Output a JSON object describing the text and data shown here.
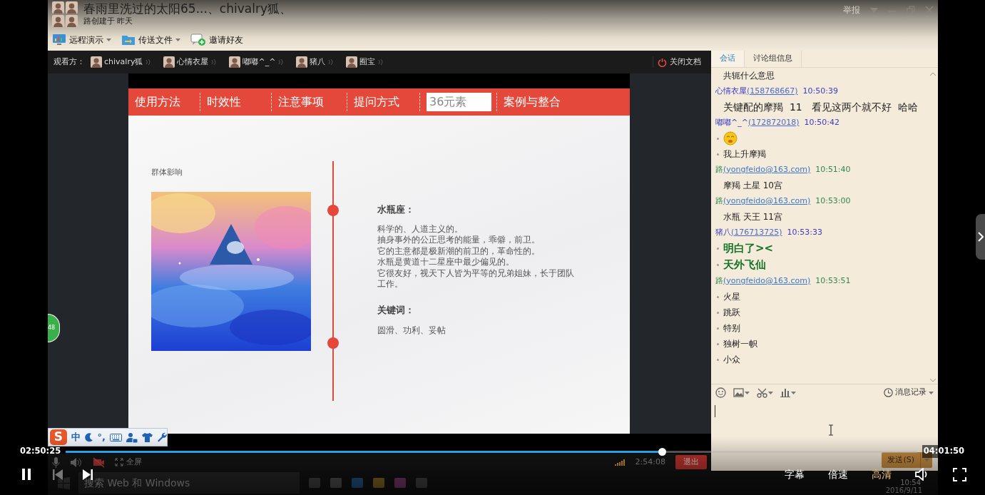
{
  "window": {
    "title": "春雨里洗过的太阳65...、chivalry狐、",
    "subtitle": "路创建于 昨天",
    "report": "举报"
  },
  "toolbar": [
    {
      "label": "远程演示",
      "dropdown": true,
      "kind": "screen"
    },
    {
      "label": "传送文件",
      "dropdown": true,
      "kind": "folder"
    },
    {
      "label": "邀请好友",
      "dropdown": false,
      "kind": "invite"
    }
  ],
  "viewers": {
    "label": "观看方：",
    "people": [
      {
        "name": "chivalry狐"
      },
      {
        "name": "心情衣屋"
      },
      {
        "name": "嘟嘟^_^"
      },
      {
        "name": "猪八"
      },
      {
        "name": "囿宝"
      }
    ]
  },
  "close_doc": "关闭文档",
  "slide": {
    "nav": [
      {
        "label": "使用方法",
        "selected": false
      },
      {
        "label": "时效性",
        "selected": false
      },
      {
        "label": "注意事项",
        "selected": false
      },
      {
        "label": "提问方式",
        "selected": false
      },
      {
        "label": "36元素",
        "selected": true
      },
      {
        "label": "案例与整合",
        "selected": false
      }
    ],
    "section": "群体影响",
    "heading": "水瓶座：",
    "lines": [
      "科学的、人道主义的。",
      "抽身事外的公正思考的能量，乖僻，前卫。",
      "它的主意都是极新潮的前卫的，革命性的。",
      "水瓶是黄道十二星座中最少偏见的。",
      "它很友好，视天下人皆为平等的兄弟姐妹，长于团队工作。"
    ],
    "keywords_heading": "关键词：",
    "keywords": "圆滑、功利、妥帖"
  },
  "badge": "48",
  "ime": {
    "logo": "S",
    "mode": "中",
    "punct": "°,"
  },
  "call_bar": {
    "camera_off": true,
    "fullscreen": "全屏",
    "duration": "2:54:08",
    "exit": "退出"
  },
  "chat": {
    "tabs": [
      {
        "label": "会话",
        "selected": true
      },
      {
        "label": "讨论组信息",
        "selected": false
      }
    ],
    "messages": [
      {
        "lines": [
          {
            "kind": "text",
            "bulleted": false,
            "text": "共轭什么意思"
          }
        ]
      },
      {
        "sender": "心情衣屋",
        "account": "(158768667)",
        "time": "10:50:39",
        "self": false,
        "lines": [
          {
            "kind": "text",
            "bulleted": false,
            "text": "关键配的摩羯  11   看见这两个就不好  哈哈"
          }
        ]
      },
      {
        "sender": "嘟嘟^_^",
        "account": "(172872018)",
        "time": "10:50:42",
        "self": false,
        "lines": [
          {
            "kind": "emoji",
            "bulleted": true
          },
          {
            "kind": "text",
            "bulleted": true,
            "text": "我上升摩羯"
          }
        ]
      },
      {
        "sender": "路",
        "account": "(yongfeido@163.com)",
        "time": "10:51:40",
        "self": true,
        "lines": [
          {
            "kind": "text",
            "bulleted": false,
            "text": "摩羯 土星 10宫"
          }
        ]
      },
      {
        "sender": "路",
        "account": "(yongfeido@163.com)",
        "time": "10:53:00",
        "self": true,
        "lines": [
          {
            "kind": "text",
            "bulleted": false,
            "text": "水瓶 天王 11宫"
          }
        ]
      },
      {
        "sender": "猪八",
        "account": "(176713725)",
        "time": "10:53:33",
        "self": false,
        "lines": [
          {
            "kind": "big",
            "bulleted": true,
            "text": "明白了><"
          },
          {
            "kind": "big",
            "bulleted": true,
            "text": "天外飞仙"
          }
        ]
      },
      {
        "sender": "路",
        "account": "(yongfeido@163.com)",
        "time": "10:53:51",
        "self": true,
        "lines": [
          {
            "kind": "text",
            "bulleted": true,
            "text": "火星"
          },
          {
            "kind": "text",
            "bulleted": true,
            "text": "跳跃"
          },
          {
            "kind": "text",
            "bulleted": true,
            "text": "特别"
          },
          {
            "kind": "text",
            "bulleted": true,
            "text": "独树一帜"
          },
          {
            "kind": "text",
            "bulleted": true,
            "text": "小众"
          }
        ]
      }
    ],
    "history": "消息记录",
    "send": "发送(S)"
  },
  "taskbar": {
    "search": "搜索 Web 和 Windows",
    "time": "10:54",
    "date": "2016/9/11"
  },
  "player": {
    "elapsed": "02:50:25",
    "total": "04:01:50",
    "level": 0.7,
    "playing": true,
    "options": [
      {
        "label": "字幕",
        "selected": false
      },
      {
        "label": "倍速",
        "selected": false
      },
      {
        "label": "高清",
        "selected": true
      }
    ]
  }
}
